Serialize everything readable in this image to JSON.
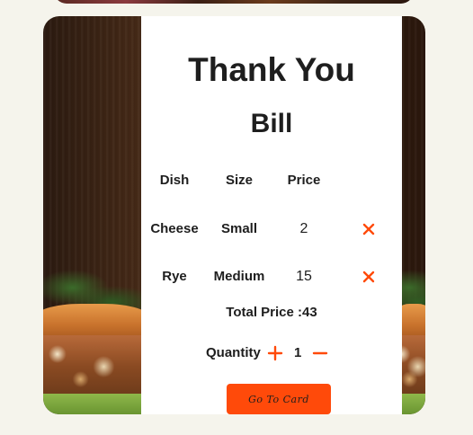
{
  "card": {
    "title": "Thank You",
    "subtitle": "Bill"
  },
  "table": {
    "headers": [
      "Dish",
      "Size",
      "Price"
    ],
    "rows": [
      {
        "dish": "Cheese",
        "size": "Small",
        "price": "2"
      },
      {
        "dish": "Rye",
        "size": "Medium",
        "price": "15"
      }
    ],
    "remove_icon": "close-icon"
  },
  "summary": {
    "total_label": "Total Price :43"
  },
  "quantity": {
    "label": "Quantity",
    "value": "1",
    "increment_icon": "plus-icon",
    "decrement_icon": "minus-icon"
  },
  "actions": {
    "go_to_card_label": "Go To Card"
  },
  "colors": {
    "accent": "#ff4a0a",
    "text": "#1e1e1e",
    "page_background": "#f5f4ec",
    "panel_background": "#ffffff"
  }
}
